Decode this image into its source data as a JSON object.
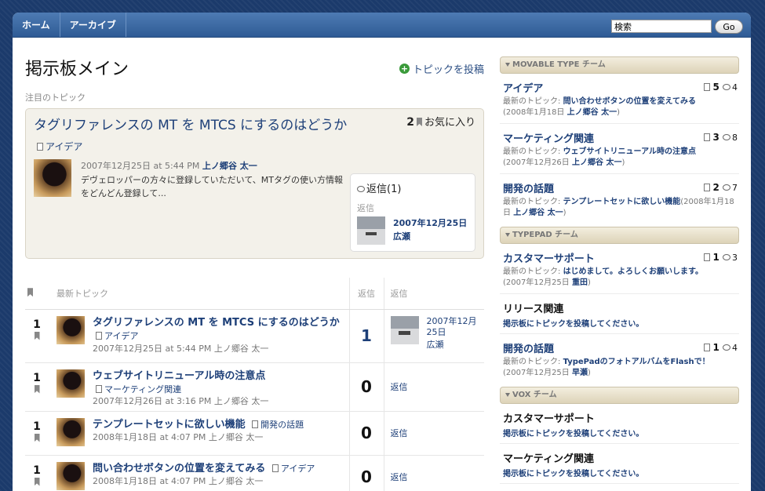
{
  "nav": {
    "home": "ホーム",
    "archive": "アーカイブ"
  },
  "search": {
    "value": "検索",
    "button": "Go"
  },
  "main": {
    "title": "掲示板メイン",
    "post_topic": "トピックを投稿",
    "featured_label": "注目のトピック",
    "featured": {
      "title": "タグリファレンスの MT を MTCS にするのはどうか",
      "category": "アイデア",
      "fav_count": "2",
      "fav_label": "お気に入り",
      "date": "2007年12月25日 at 5:44 PM",
      "author": "上ノ郷谷 太一",
      "excerpt": "デヴェロッパーの方々に登録していただいて、MTタグの使い方情報をどんどん登録して...",
      "reply_title": "返信(1)",
      "reply_sub": "返信",
      "reply_date": "2007年12月25日",
      "reply_author": "広瀬"
    },
    "table": {
      "header_latest": "最新トピック",
      "header_replies": "返信",
      "header_reply": "返信",
      "rows": [
        {
          "fav": "1",
          "title": "タグリファレンスの MT を MTCS にするのはどうか",
          "category": "アイデア",
          "meta": "2007年12月25日 at 5:44 PM 上ノ郷谷 太一",
          "count": "1",
          "reply_date": "2007年12月25日",
          "reply_author": "広瀬"
        },
        {
          "fav": "1",
          "title": "ウェブサイトリニューアル時の注意点",
          "category": "マーケティング関連",
          "meta": "2007年12月26日 at 3:16 PM 上ノ郷谷 太一",
          "count": "0",
          "reply": "返信"
        },
        {
          "fav": "1",
          "title": "テンプレートセットに欲しい機能",
          "category": "開発の話題",
          "meta": "2008年1月18日 at 4:07 PM 上ノ郷谷 太一",
          "count": "0",
          "reply": "返信"
        },
        {
          "fav": "1",
          "title": "問い合わせボタンの位置を変えてみる",
          "category": "アイデア",
          "meta": "2008年1月18日 at 4:07 PM 上ノ郷谷 太一",
          "count": "0",
          "reply": "返信"
        }
      ]
    }
  },
  "sidebar": {
    "latest_prefix": "最新のトピック:",
    "mt": {
      "head": "MOVABLE TYPE チーム",
      "items": [
        {
          "title": "アイデア",
          "topics": "5",
          "replies": "4",
          "latest": "問い合わせボタンの位置を変えてみる",
          "date": "(2008年1月18日",
          "author": "上ノ郷谷 太一",
          "close": ")"
        },
        {
          "title": "マーケティング関連",
          "topics": "3",
          "replies": "8",
          "latest": "ウェブサイトリニューアル時の注意点",
          "date": "(2007年12月26日",
          "author": "上ノ郷谷 太一",
          "close": ")"
        },
        {
          "title": "開発の話題",
          "topics": "2",
          "replies": "7",
          "latest": "テンプレートセットに欲しい機能",
          "date": "(2008年1月18日",
          "author": "上ノ郷谷 太一",
          "close": ")"
        }
      ]
    },
    "tp": {
      "head": "TYPEPAD チーム",
      "items": [
        {
          "title": "カスタマーサポート",
          "topics": "1",
          "replies": "3",
          "latest": "はじめまして。よろしくお願いします。",
          "date": "(2007年12月25日",
          "author": "重田",
          "close": ")"
        },
        {
          "title": "リリース関連",
          "link": "掲示板にトピックを投稿してください。"
        },
        {
          "title": "開発の話題",
          "topics": "1",
          "replies": "4",
          "latest": "TypePadのフォトアルバムをFlashで！",
          "date": "(2007年12月25日",
          "author": "早瀬",
          "close": ")"
        }
      ]
    },
    "vox": {
      "head": "VOX チーム",
      "items": [
        {
          "title": "カスタマーサポート",
          "link": "掲示板にトピックを投稿してください。"
        },
        {
          "title": "マーケティング関連",
          "link": "掲示板にトピックを投稿してください。"
        }
      ]
    }
  }
}
